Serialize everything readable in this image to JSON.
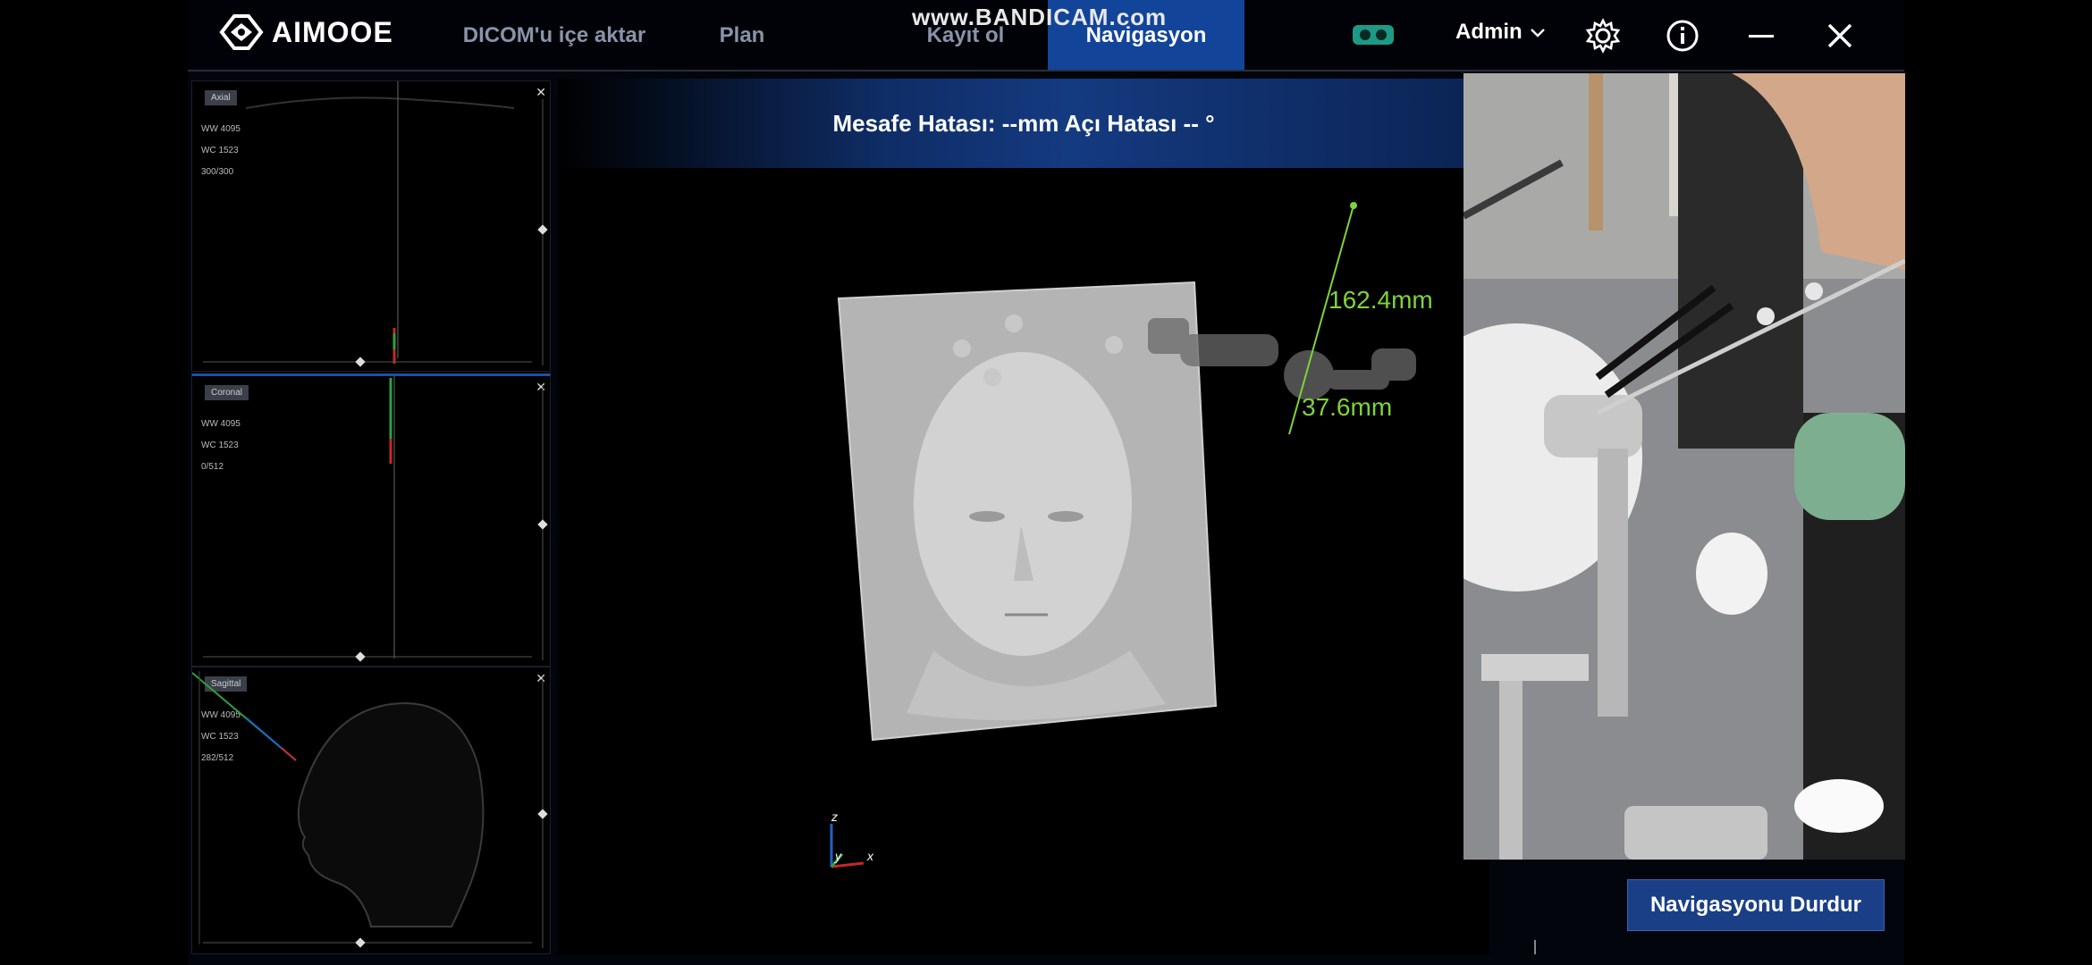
{
  "app": {
    "logo_text": "AIMOOE",
    "watermark": "www.BANDICAM.com"
  },
  "tabs": [
    {
      "label": "DICOM'u içe aktar",
      "active": false
    },
    {
      "label": "Plan",
      "active": false
    },
    {
      "label": "Kayıt ol",
      "active": false
    },
    {
      "label": "Navigasyon",
      "active": true
    }
  ],
  "topbar": {
    "user_label": "Admin",
    "icons": [
      "vr-glasses-icon",
      "gear-icon",
      "info-icon",
      "minimize-icon",
      "close-icon"
    ]
  },
  "panels": [
    {
      "label": "Axial",
      "info": [
        "WW 4095",
        "WC 1523",
        "300/300"
      ]
    },
    {
      "label": "Coronal",
      "info": [
        "WW 4095",
        "WC 1523",
        "0/512"
      ]
    },
    {
      "label": "Sagittal",
      "info": [
        "WW 4095",
        "WC 1523",
        "282/512"
      ]
    }
  ],
  "navigation": {
    "error_text": "Mesafe Hatası: --mm  Açı Hatası -- °",
    "measure_1": "162.4mm",
    "measure_2": "37.6mm",
    "axis_labels": {
      "z": "z",
      "y": "y",
      "x": "x"
    },
    "stop_button": "Navigasyonu Durdur"
  },
  "colors": {
    "accent": "#12449a",
    "button": "#1a3f86",
    "measure_green": "#7fd33a",
    "vr": "#1d9a86"
  }
}
